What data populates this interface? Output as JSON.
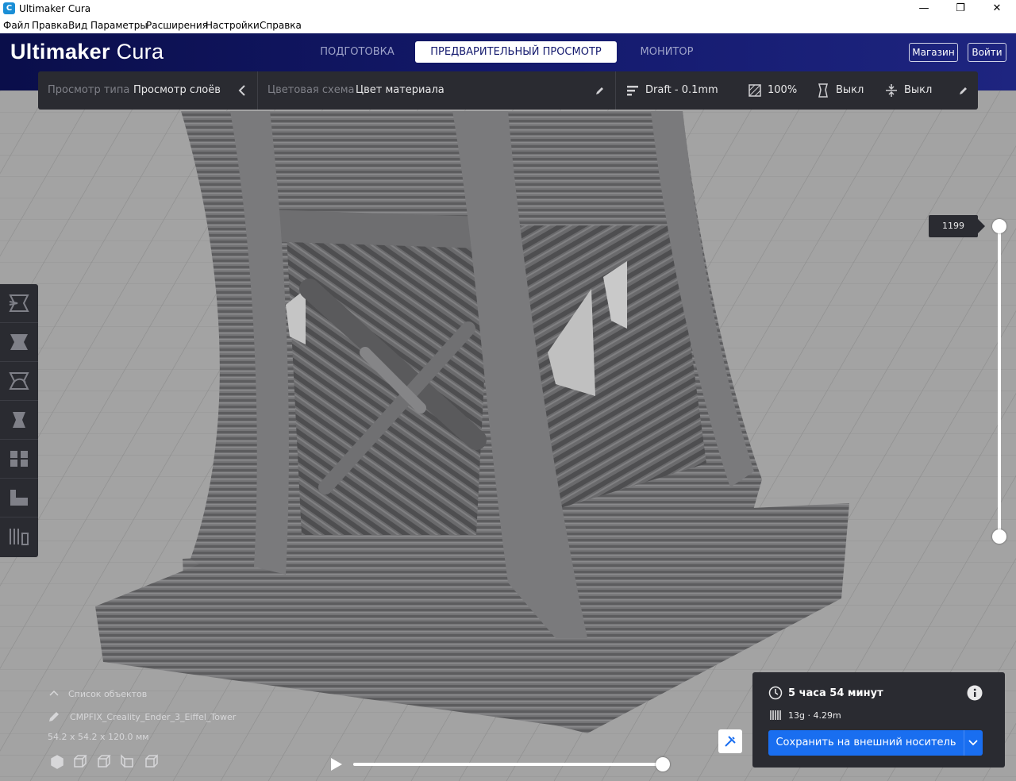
{
  "window": {
    "title": "Ultimaker Cura",
    "controls": {
      "minimize": "—",
      "maximize": "❐",
      "close": "✕"
    }
  },
  "menu": [
    "Файл",
    "Правка",
    "Вид",
    "Параметры",
    "Расширения",
    "Настройки",
    "Справка"
  ],
  "header": {
    "brand_bold": "Ultimaker",
    "brand_light": " Cura",
    "stages": [
      "ПОДГОТОВКА",
      "ПРЕДВАРИТЕЛЬНЫЙ ПРОСМОТР",
      "МОНИТОР"
    ],
    "active_stage": "ПРЕДВАРИТЕЛЬНЫЙ ПРОСМОТР",
    "marketplace_label": "Магазин",
    "signin_label": "Войти"
  },
  "toolbar": {
    "view_type_label": "Просмотр типа",
    "view_type_value": "Просмотр слоёв",
    "color_scheme_label": "Цветовая схема",
    "color_scheme_value": "Цвет материала",
    "profile": "Draft - 0.1mm",
    "infill": "100%",
    "support": "Выкл",
    "adhesion": "Выкл"
  },
  "layer_slider": {
    "current_layer": "1199"
  },
  "objects": {
    "list_label": "Список объектов",
    "name": "CMPFIX_Creality_Ender_3_Eiffel_Tower",
    "dimensions": "54.2 x 54.2 x 120.0 мм"
  },
  "print": {
    "time": "5 часа 54 минут",
    "material": "13g · 4.29m",
    "save_label": "Сохранить на внешний носитель"
  },
  "colors": {
    "accent": "#196ef0",
    "header": "#141a6e",
    "panel": "#2a2b31",
    "model": "#6e6e70"
  }
}
